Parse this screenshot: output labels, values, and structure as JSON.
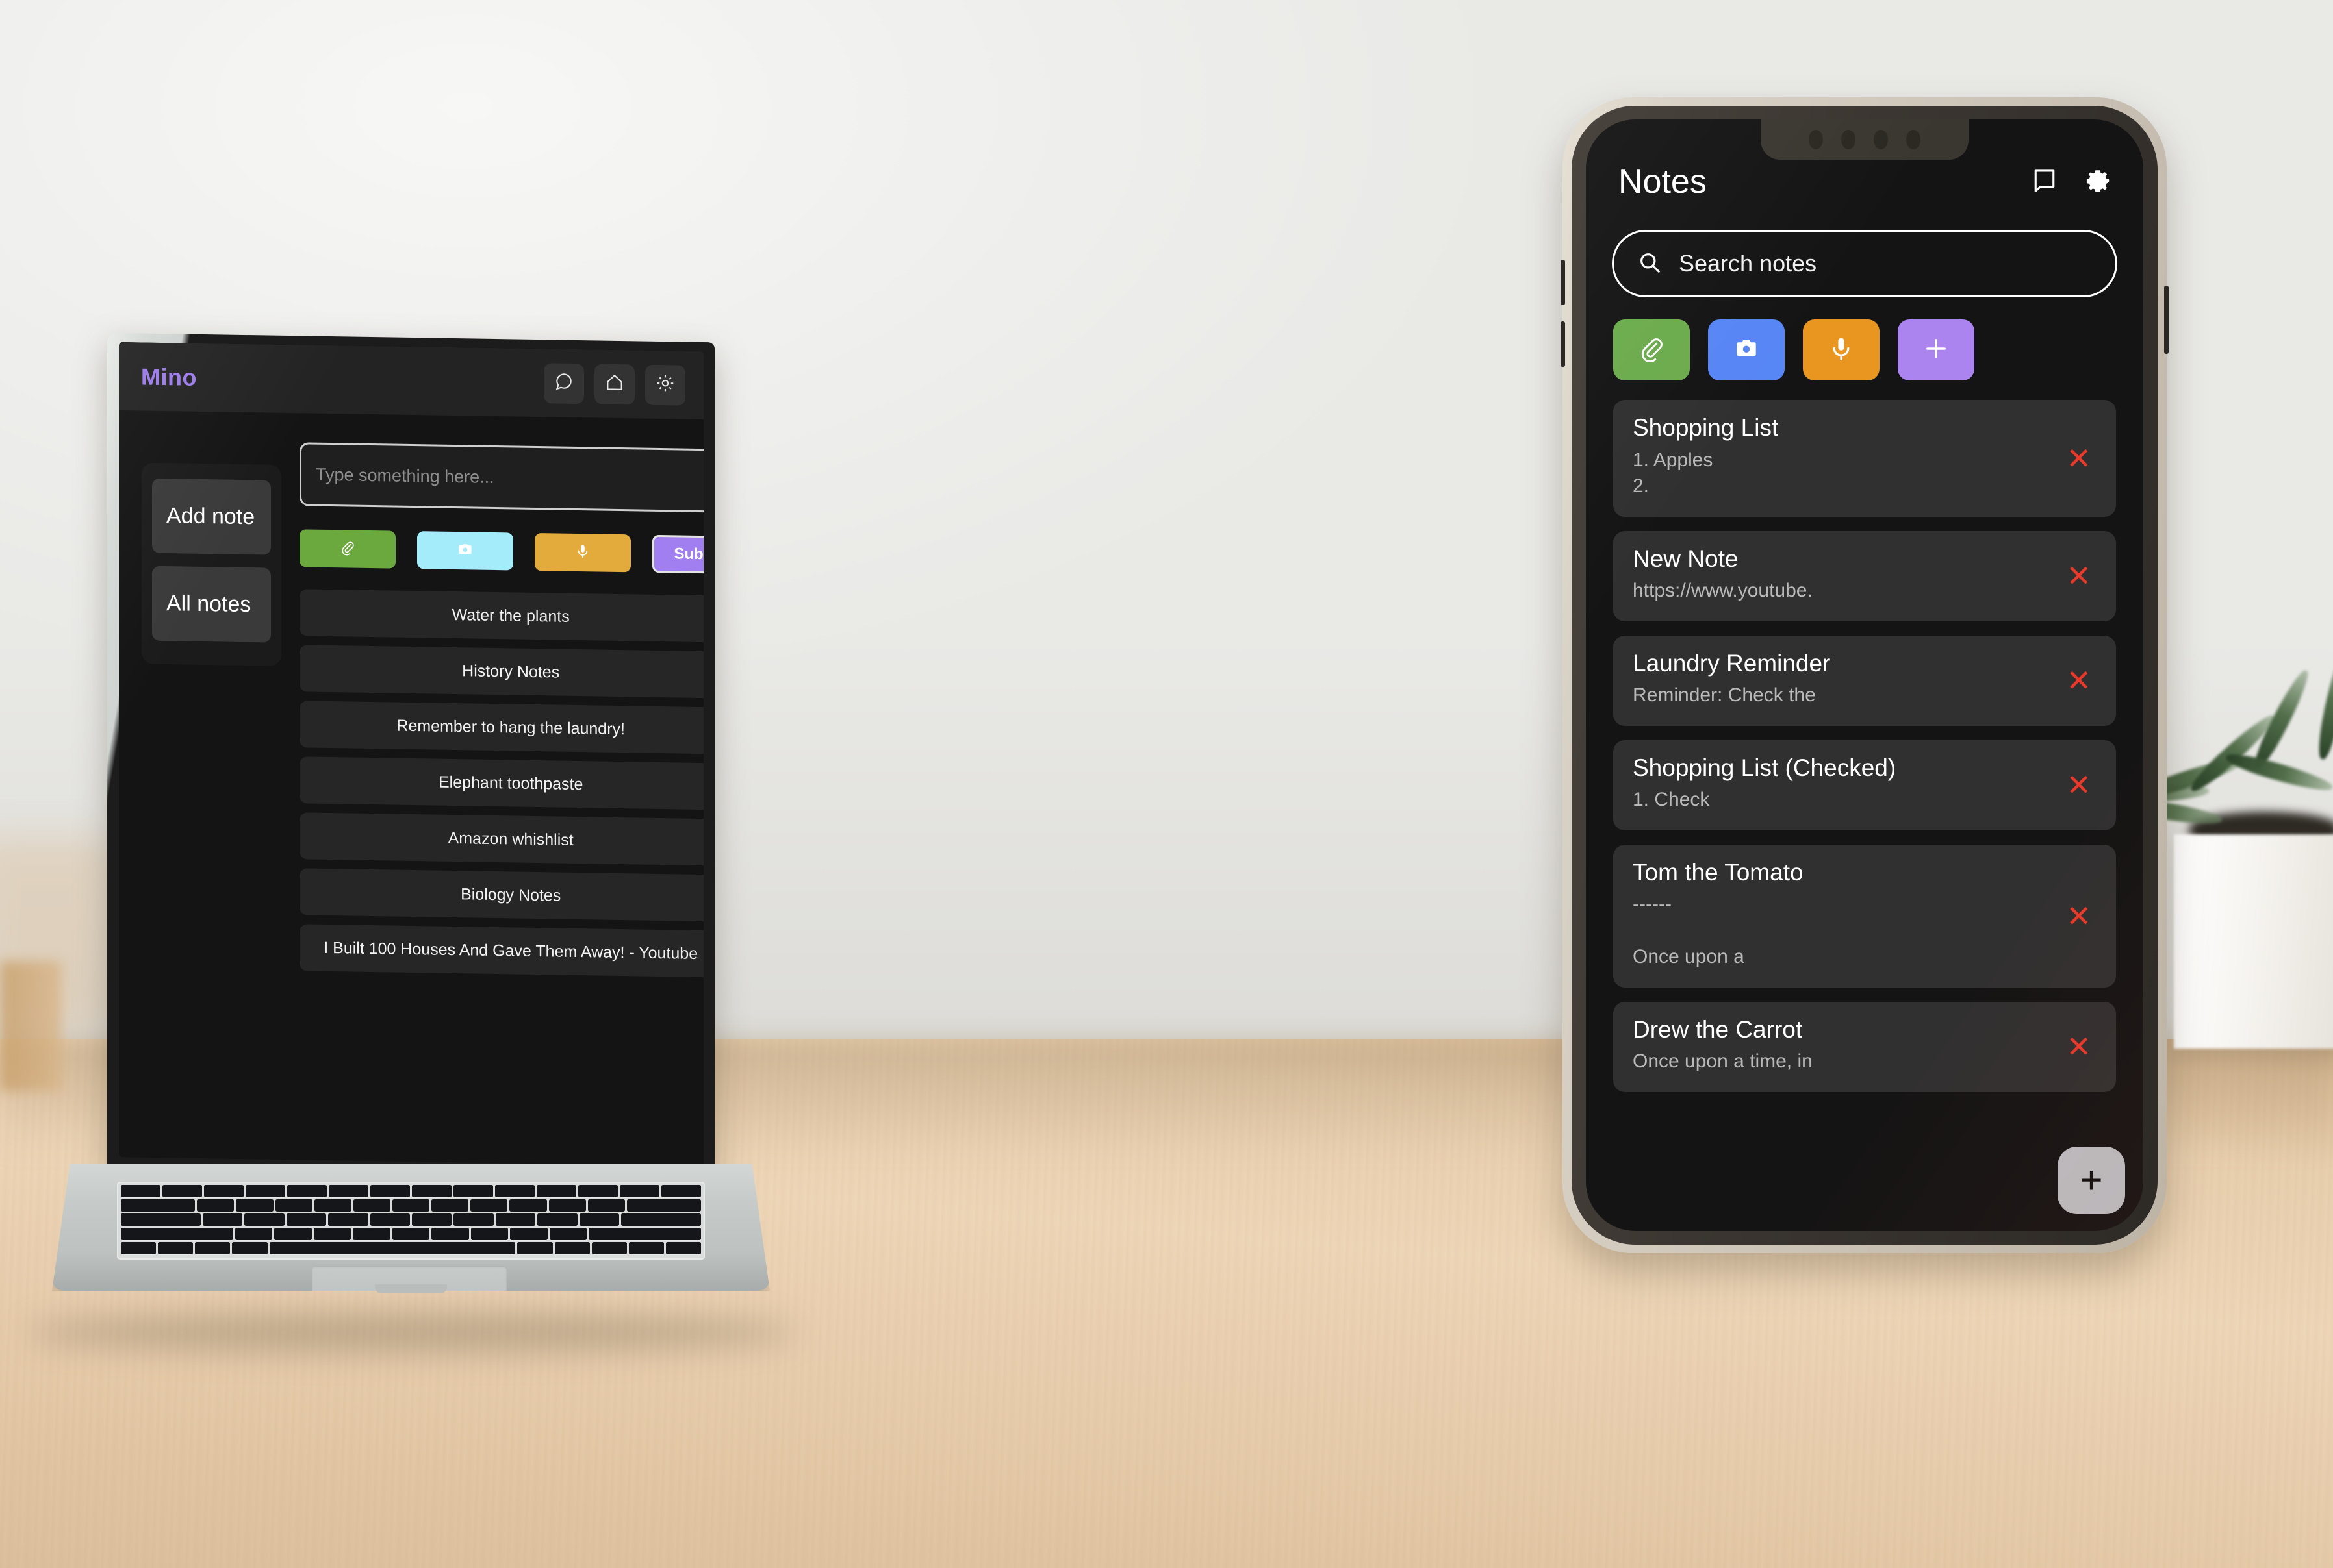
{
  "scene": {
    "wall_color": "#eeeeec",
    "desk_color": "#e8cfae",
    "plant_label": "potted-succulent"
  },
  "laptop": {
    "app": {
      "brand": "Mino",
      "header_icons": [
        {
          "name": "chat-icon",
          "label": "Chat"
        },
        {
          "name": "home-icon",
          "label": "Home"
        },
        {
          "name": "gear-icon",
          "label": "Settings"
        }
      ],
      "sidebar": {
        "items": [
          {
            "label": "Add note"
          },
          {
            "label": "All notes"
          }
        ]
      },
      "input": {
        "placeholder": "Type something here...",
        "value": ""
      },
      "action_buttons": [
        {
          "label": "",
          "icon": "paperclip-icon",
          "color": "#6ba83e"
        },
        {
          "label": "",
          "icon": "camera-icon",
          "color": "#a5ecfa"
        },
        {
          "label": "",
          "icon": "microphone-icon",
          "color": "#e3ab3c"
        },
        {
          "label": "Submit",
          "icon": "",
          "color": "#a27ff0"
        }
      ],
      "notes": [
        {
          "title": "Water the plants",
          "close": "✕"
        },
        {
          "title": "History Notes",
          "close": "✕"
        },
        {
          "title": "Remember to hang the laundry!",
          "close": "✕"
        },
        {
          "title": "Elephant toothpaste",
          "close": "✕"
        },
        {
          "title": "Amazon whishlist",
          "close": "✕"
        },
        {
          "title": "Biology Notes",
          "close": "✕"
        },
        {
          "title": "I Built 100 Houses And Gave Them Away! - Youtube",
          "close": "✕"
        }
      ]
    }
  },
  "phone": {
    "app": {
      "title": "Notes",
      "header_icons": [
        {
          "name": "note-icon",
          "label": "Notes view"
        },
        {
          "name": "gear-icon",
          "label": "Settings"
        }
      ],
      "search": {
        "placeholder": "Search notes",
        "value": ""
      },
      "action_buttons": [
        {
          "icon": "paperclip-icon",
          "color": "#6cab4d"
        },
        {
          "icon": "camera-icon",
          "color": "#5786f5"
        },
        {
          "icon": "microphone-icon",
          "color": "#e89620"
        },
        {
          "icon": "plus-icon",
          "color": "#ab84f0"
        }
      ],
      "notes": [
        {
          "title": "Shopping List",
          "preview": "1. Apples\n2.",
          "close": "✕"
        },
        {
          "title": "New Note",
          "preview": "https://www.youtube.",
          "close": "✕"
        },
        {
          "title": "Laundry Reminder",
          "preview": "Reminder: Check the",
          "close": "✕"
        },
        {
          "title": "Shopping List (Checked)",
          "preview": "1. Check",
          "close": "✕"
        },
        {
          "title": "Tom the Tomato",
          "preview": "------\n\nOnce upon a",
          "close": "✕"
        },
        {
          "title": "Drew the Carrot",
          "preview": "Once upon a time, in",
          "close": "✕"
        }
      ],
      "fab": {
        "label": "+",
        "name": "add-note-fab"
      }
    }
  }
}
